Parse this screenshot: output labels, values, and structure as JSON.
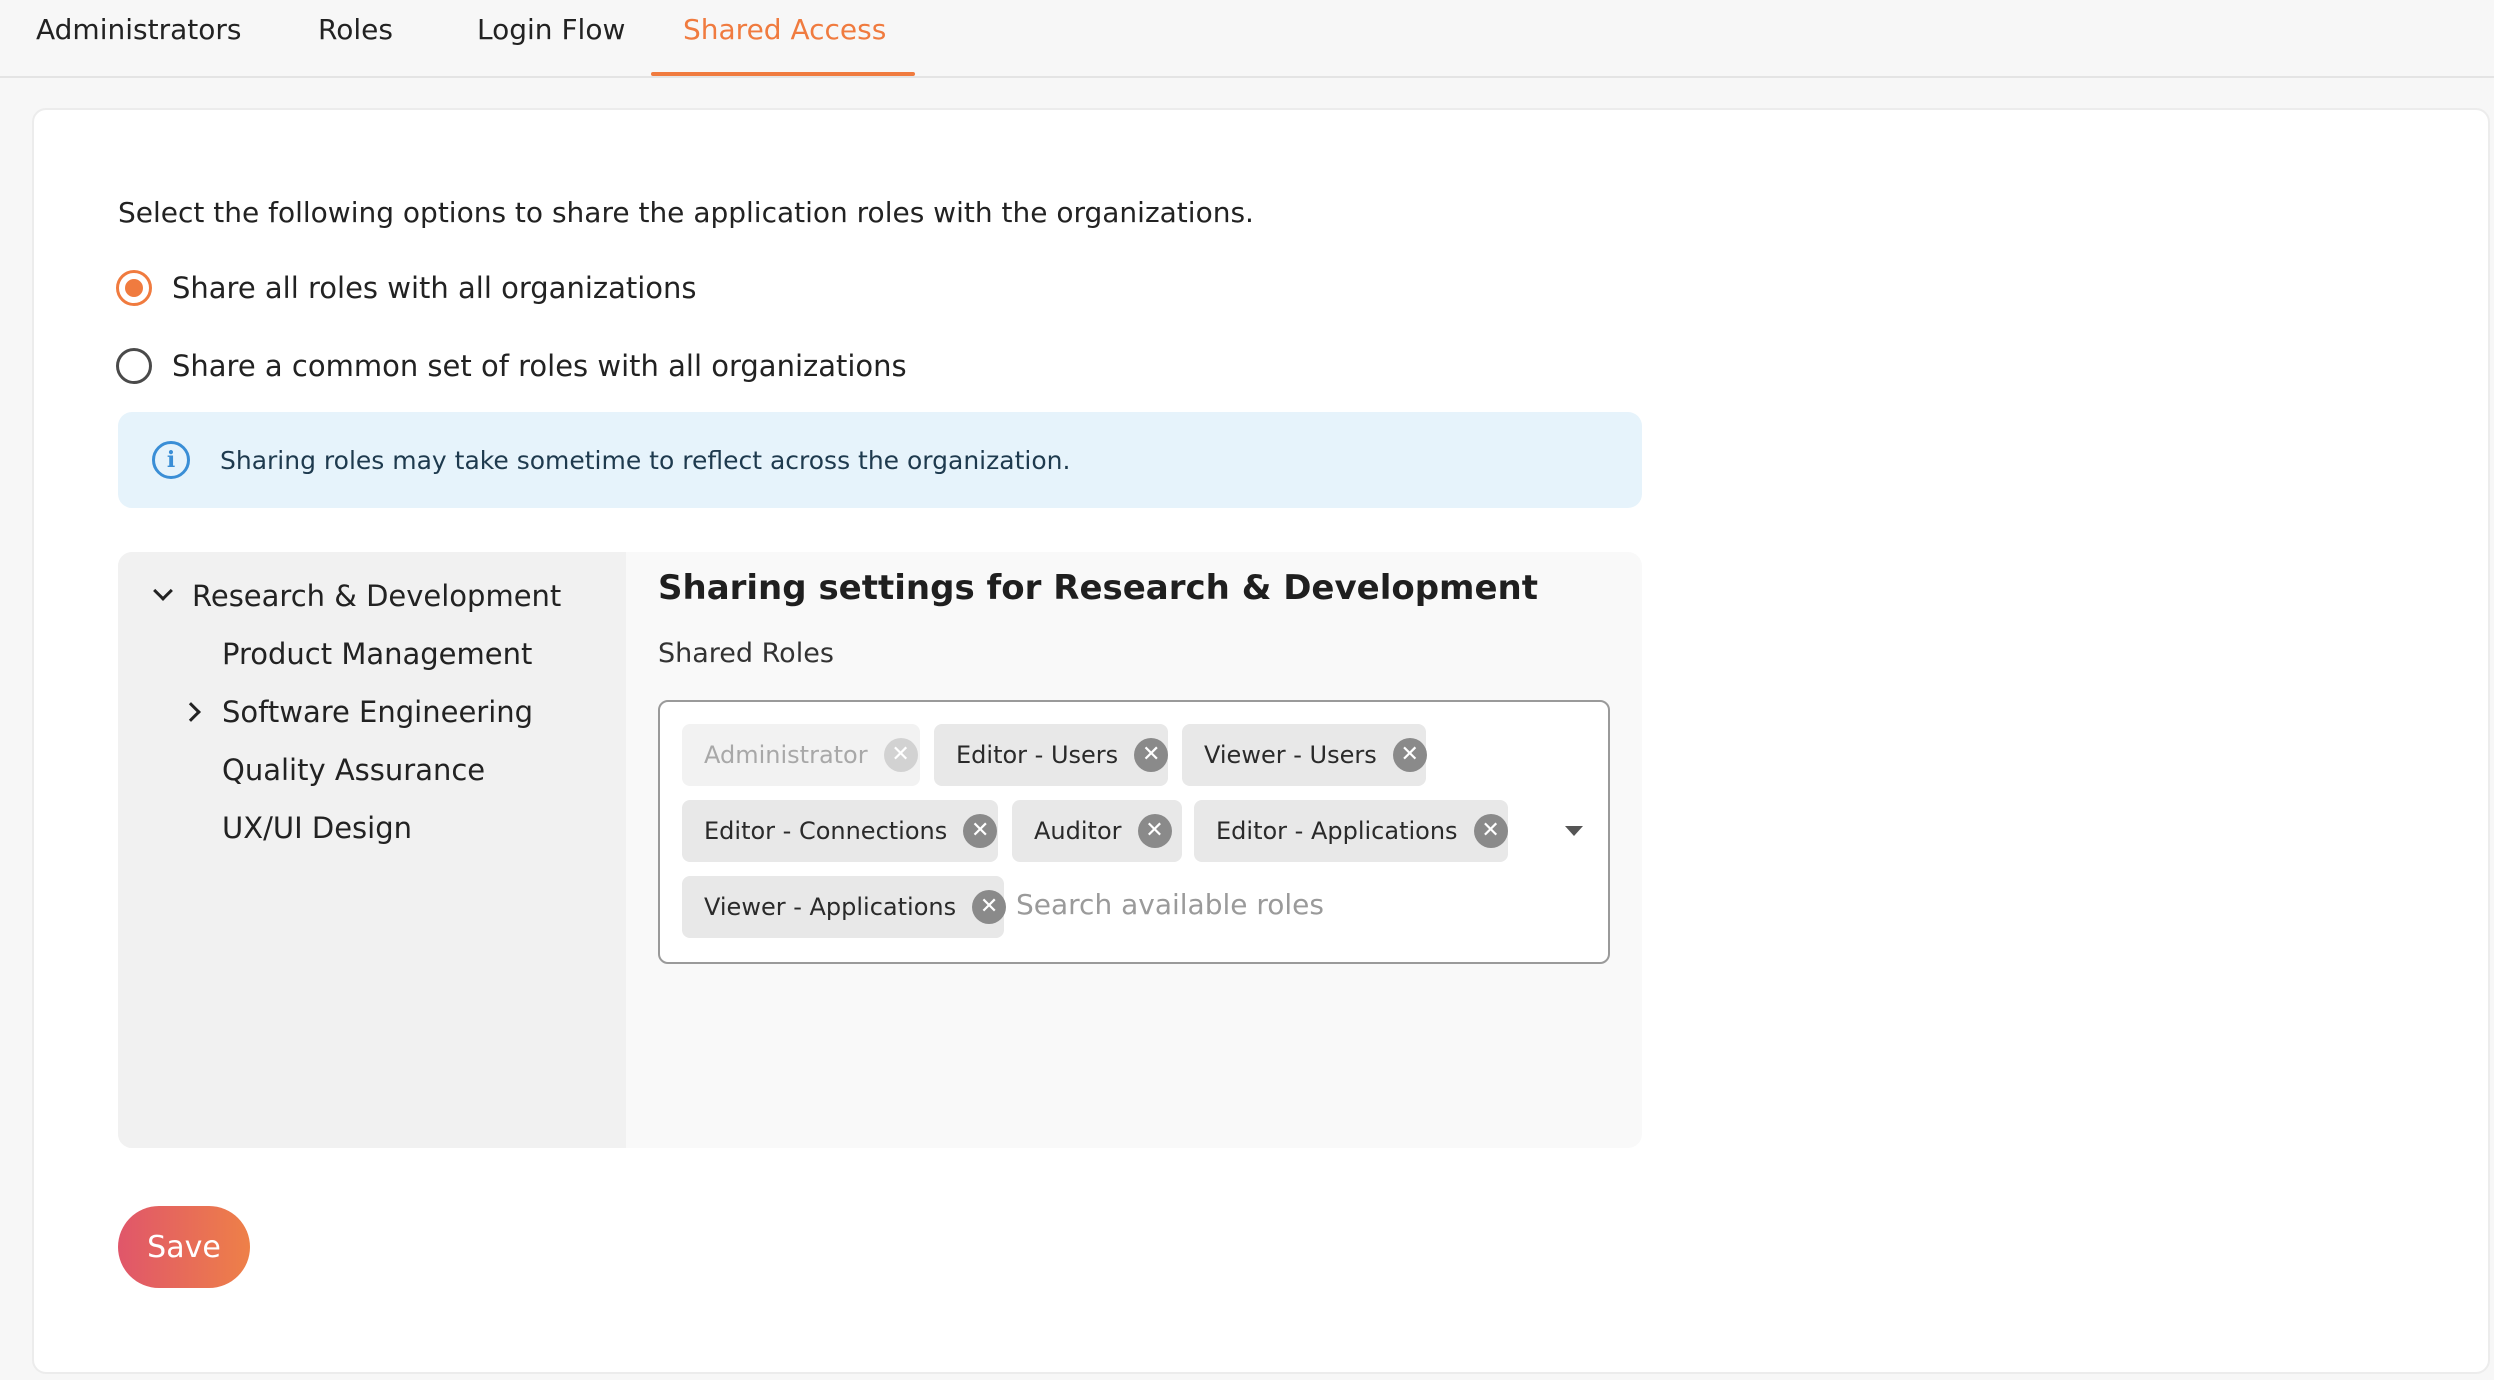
{
  "tabs": [
    {
      "label": "Administrators",
      "active": false
    },
    {
      "label": "Roles",
      "active": false
    },
    {
      "label": "Login Flow",
      "active": false
    },
    {
      "label": "Shared Access",
      "active": true
    }
  ],
  "intro_text": "Select the following options to share the application roles with the organizations.",
  "options": [
    {
      "label": "Share all roles with all organizations",
      "selected": true
    },
    {
      "label": "Share a common set of roles with all organizations",
      "selected": false
    }
  ],
  "info_banner": {
    "text": "Sharing roles may take sometime to reflect across the organization.",
    "icon": "info-icon"
  },
  "org_tree": [
    {
      "label": "Research & Development",
      "expanded": true
    },
    {
      "label": "Product Management"
    },
    {
      "label": "Software Engineering",
      "expanded": false
    },
    {
      "label": "Quality Assurance"
    },
    {
      "label": "UX/UI Design"
    }
  ],
  "sharing": {
    "title": "Sharing settings for Research & Development",
    "field_label": "Shared Roles",
    "roles": [
      {
        "label": "Administrator",
        "disabled": true
      },
      {
        "label": "Editor - Users"
      },
      {
        "label": "Viewer - Users"
      },
      {
        "label": "Editor - Connections"
      },
      {
        "label": "Auditor"
      },
      {
        "label": "Editor - Applications"
      },
      {
        "label": "Viewer - Applications"
      }
    ],
    "search_placeholder": "Search available roles"
  },
  "save_label": "Save",
  "colors": {
    "accent": "#f07b3f",
    "info_bg": "#e6f3fb",
    "info_icon": "#3a8ed6"
  }
}
